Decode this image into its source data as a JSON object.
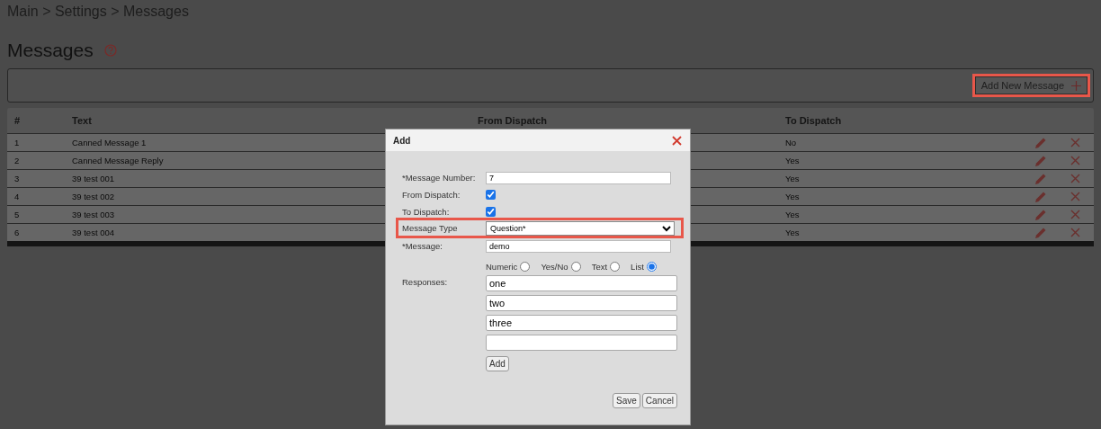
{
  "breadcrumb": "Main > Settings > Messages",
  "page_title": "Messages",
  "toolbar": {
    "add_button": {
      "label": "Add New Message",
      "highlighted": true
    }
  },
  "table": {
    "columns": [
      "#",
      "Text",
      "From Dispatch",
      "To Dispatch"
    ],
    "rows": [
      {
        "number": "1",
        "text": "Canned Message 1",
        "to_dispatch": "No"
      },
      {
        "number": "2",
        "text": "Canned Message Reply",
        "to_dispatch": "Yes"
      },
      {
        "number": "3",
        "text": "39 test 001",
        "to_dispatch": "Yes"
      },
      {
        "number": "4",
        "text": "39 test 002",
        "to_dispatch": "Yes"
      },
      {
        "number": "5",
        "text": "39 test 003",
        "to_dispatch": "Yes"
      },
      {
        "number": "6",
        "text": "39 test 004",
        "to_dispatch": "Yes"
      }
    ]
  },
  "dialog": {
    "title": "Add",
    "fields": [
      {
        "kind": "text",
        "label": "*Message Number:",
        "value": "7"
      },
      {
        "kind": "checkbox",
        "label": "From Dispatch:",
        "checked": true
      },
      {
        "kind": "checkbox",
        "label": "To Dispatch:",
        "checked": true
      },
      {
        "kind": "select",
        "label": "Message Type",
        "value": "Question*",
        "highlighted": true
      },
      {
        "kind": "text",
        "label": "*Message:",
        "value": "demo"
      }
    ],
    "response_types": [
      {
        "label": "Numeric",
        "selected": false
      },
      {
        "label": "Yes/No",
        "selected": false
      },
      {
        "label": "Text",
        "selected": false
      },
      {
        "label": "List",
        "selected": true
      }
    ],
    "responses_label": "Responses:",
    "responses": [
      {
        "kind": "filled",
        "value": "one"
      },
      {
        "kind": "filled",
        "value": "two"
      },
      {
        "kind": "filled",
        "value": "three"
      },
      {
        "kind": "blank"
      }
    ],
    "add_button": "Add",
    "buttons": [
      "Save",
      "Cancel"
    ]
  }
}
